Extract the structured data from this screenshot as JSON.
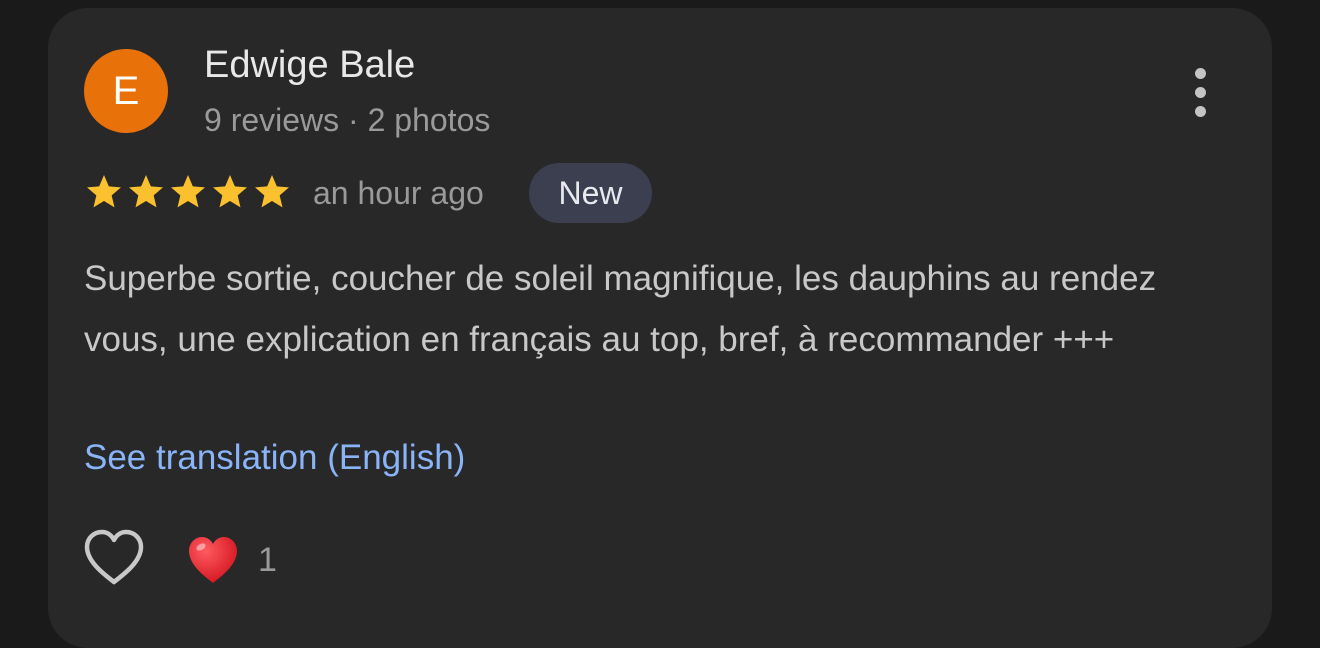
{
  "review": {
    "avatar_initial": "E",
    "reviewer_name": "Edwige Bale",
    "reviewer_meta": "9 reviews · 2 photos",
    "rating": 5,
    "rating_max": 5,
    "timestamp": "an hour ago",
    "badge": "New",
    "text": "Superbe sortie, coucher de soleil magnifique, les dauphins au rendez vous, une explication en français au top, bref, à recommander +++",
    "translate_link": "See translation (English)",
    "reaction_count": "1"
  },
  "icons": {
    "menu": "more-vert-icon",
    "star": "star-icon",
    "like": "heart-outline-icon",
    "reaction": "red-heart-icon"
  },
  "colors": {
    "background": "#1a1a1a",
    "card": "#282828",
    "avatar": "#e8710a",
    "star": "#fbc02d",
    "link": "#8ab4f8",
    "badge": "#3b3f4f",
    "heart": "#e0202e"
  }
}
